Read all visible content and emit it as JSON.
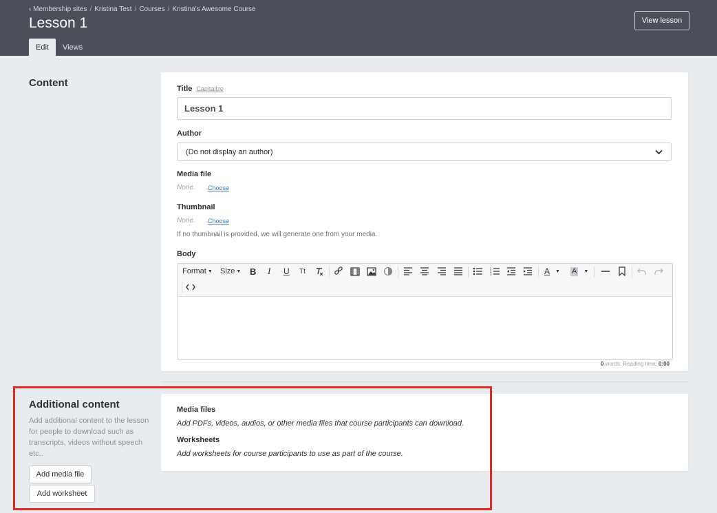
{
  "header": {
    "breadcrumb": [
      "‹ Membership sites",
      "Kristina Test",
      "Courses",
      "Kristina's Awesome Course"
    ],
    "breadcrumb_sep": "/",
    "title": "Lesson 1",
    "view_lesson_label": "View lesson",
    "tabs": [
      {
        "label": "Edit",
        "active": true
      },
      {
        "label": "Views",
        "active": false
      }
    ]
  },
  "content_section": {
    "title": "Content",
    "title_field": {
      "label": "Title",
      "action": "Capitalize",
      "value": "Lesson 1"
    },
    "author_field": {
      "label": "Author",
      "selected": "(Do not display an author)"
    },
    "media_file": {
      "label": "Media file",
      "value": "None.",
      "action": "Choose"
    },
    "thumbnail": {
      "label": "Thumbnail",
      "value": "None.",
      "action": "Choose",
      "hint": "If no thumbnail is provided, we will generate one from your media."
    },
    "body": {
      "label": "Body",
      "toolbar": {
        "format": "Format",
        "size": "Size",
        "tt": "Tt"
      },
      "word_count": "0",
      "words_text": " words. Reading time: ",
      "reading_time": "0:00"
    }
  },
  "additional_section": {
    "title": "Additional content",
    "description": "Add additional content to the lesson for people to download such as transcripts, videos without speech etc..",
    "add_media_label": "Add media file",
    "add_worksheet_label": "Add worksheet",
    "media_files_title": "Media files",
    "media_files_desc": "Add PDFs, videos, audios, or other media files that course participants can download.",
    "worksheets_title": "Worksheets",
    "worksheets_desc": "Add worksheets for course participants to use as part of the course."
  },
  "colors": {
    "header_bg": "#4a4f5a",
    "page_bg": "#e9ecef",
    "link": "#3a78b8",
    "highlight": "#e8271f"
  }
}
